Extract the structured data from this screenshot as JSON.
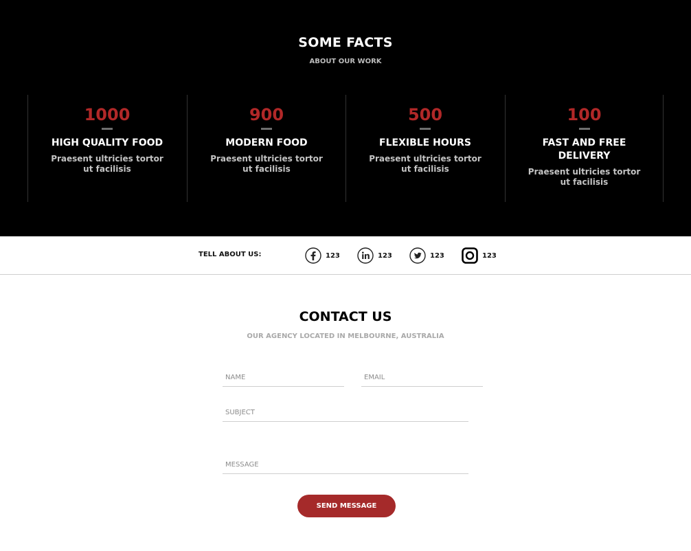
{
  "facts": {
    "title": "SOME FACTS",
    "subtitle": "ABOUT OUR WORK",
    "items": [
      {
        "number": "1000",
        "heading": "HIGH QUALITY FOOD",
        "text": "Praesent ultricies tortor ut facilisis"
      },
      {
        "number": "900",
        "heading": "MODERN FOOD",
        "text": "Praesent ultricies tortor ut facilisis"
      },
      {
        "number": "500",
        "heading": "FLEXIBLE HOURS",
        "text": "Praesent ultricies tortor ut facilisis"
      },
      {
        "number": "100",
        "heading": "FAST AND FREE DELIVERY",
        "text": "Praesent ultricies tortor ut facilisis"
      }
    ]
  },
  "social": {
    "label": "TELL ABOUT US:",
    "items": [
      {
        "icon": "facebook-icon",
        "count": "123"
      },
      {
        "icon": "linkedin-icon",
        "count": "123"
      },
      {
        "icon": "twitter-icon",
        "count": "123"
      },
      {
        "icon": "instagram-icon",
        "count": "123"
      }
    ]
  },
  "contact": {
    "title": "CONTACT US",
    "subtitle": "OUR AGENCY LOCATED IN MELBOURNE, AUSTRALIA",
    "name_placeholder": "NAME",
    "email_placeholder": "EMAIL",
    "subject_placeholder": "SUBJECT",
    "message_placeholder": "MESSAGE",
    "send_label": "SEND MESSAGE"
  },
  "colors": {
    "accent": "#a52a2a",
    "number": "#b12828",
    "dark_bg": "#000000"
  }
}
